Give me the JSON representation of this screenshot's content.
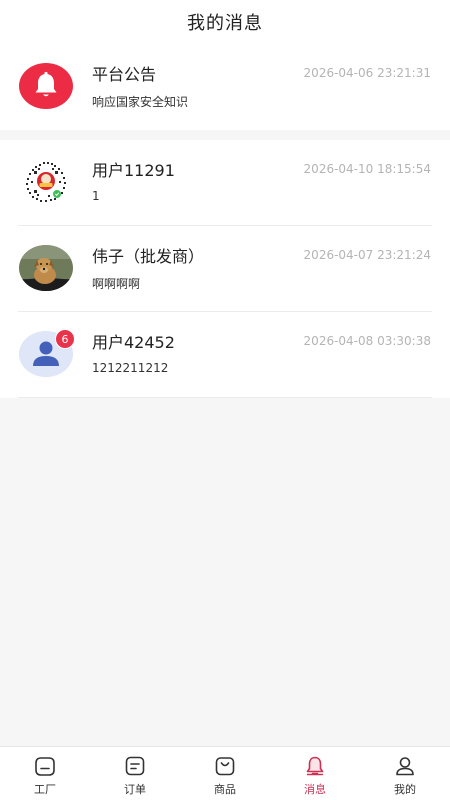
{
  "header": {
    "title": "我的消息"
  },
  "announcement": {
    "name": "平台公告",
    "time": "2026-04-06 23:21:31",
    "preview": "响应国家安全知识",
    "icon": "bell-icon",
    "color": "#ec2b45"
  },
  "conversations": [
    {
      "name": "用户11291",
      "time": "2026-04-10 18:15:54",
      "preview": "1",
      "avatar": "qr-code-avatar"
    },
    {
      "name": "伟子（批发商）",
      "time": "2026-04-07 23:21:24",
      "preview": "啊啊啊啊",
      "avatar": "dog-photo-avatar"
    },
    {
      "name": "用户42452",
      "time": "2026-04-08 03:30:38",
      "preview": "1212211212",
      "avatar": "default-user-avatar",
      "badge": "6"
    }
  ],
  "tabs": [
    {
      "label": "工厂",
      "icon": "factory-icon"
    },
    {
      "label": "订单",
      "icon": "order-icon"
    },
    {
      "label": "商品",
      "icon": "shopping-bag-icon"
    },
    {
      "label": "消息",
      "icon": "bell-icon",
      "active": true
    },
    {
      "label": "我的",
      "icon": "user-icon"
    }
  ],
  "colors": {
    "accent": "#c93354",
    "badge": "#e8334a",
    "background": "#f6f6f6",
    "time_text": "#b4b4b4"
  }
}
